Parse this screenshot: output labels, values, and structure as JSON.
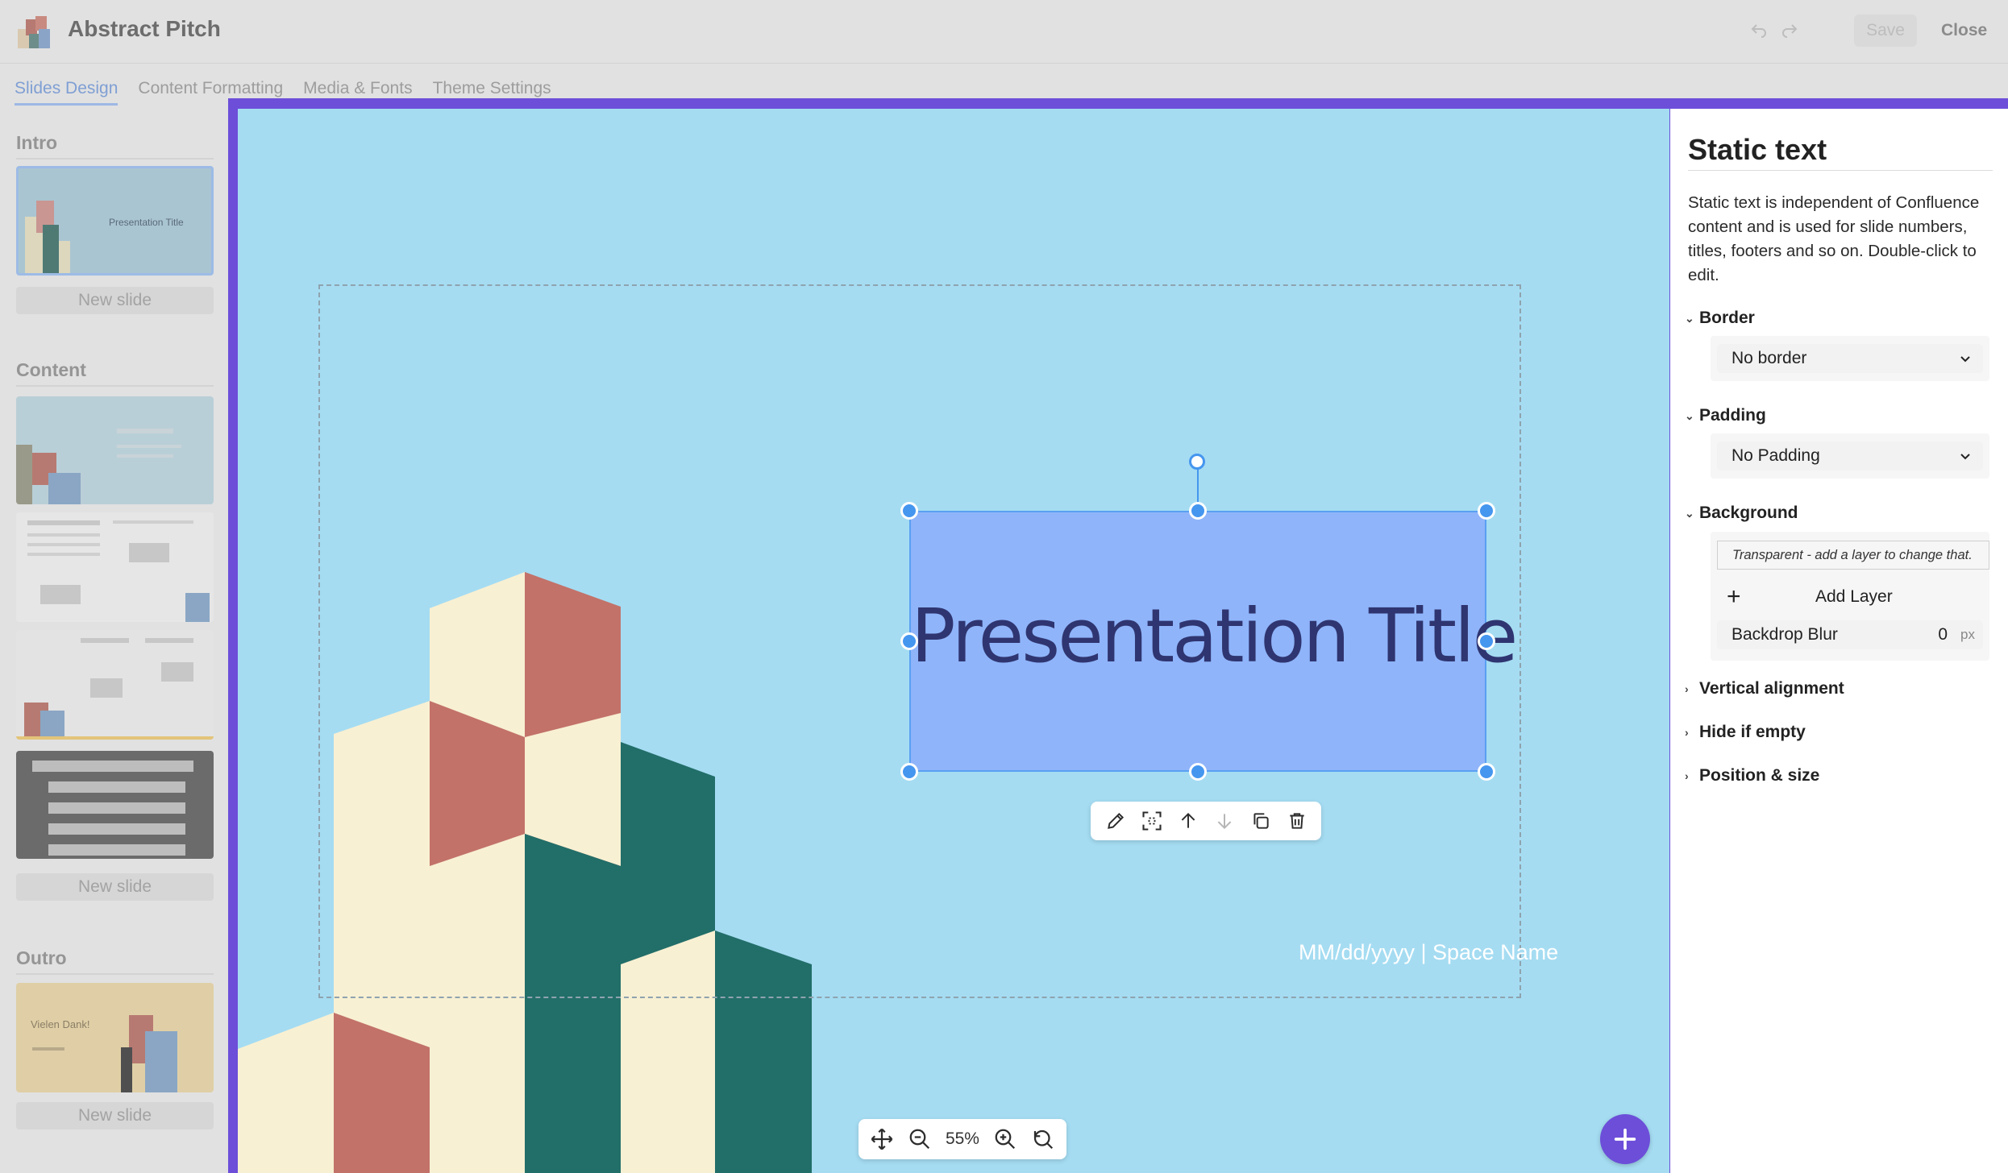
{
  "app": {
    "title": "Abstract Pitch",
    "save_label": "Save",
    "close_label": "Close"
  },
  "tabs": [
    {
      "label": "Slides Design",
      "active": true
    },
    {
      "label": "Content Formatting",
      "active": false
    },
    {
      "label": "Media & Fonts",
      "active": false
    },
    {
      "label": "Theme Settings",
      "active": false
    }
  ],
  "sidebar": {
    "intro": {
      "title": "Intro",
      "thumb_text": "Presentation Title",
      "new_slide": "New slide"
    },
    "content": {
      "title": "Content",
      "new_slide": "New slide"
    },
    "outro": {
      "title": "Outro",
      "thumb_text": "Vielen Dank!",
      "new_slide": "New slide"
    }
  },
  "slide": {
    "title": "Presentation Title",
    "footer": "MM/dd/yyyy | Space Name"
  },
  "zoom": {
    "value": "55%"
  },
  "panel": {
    "title": "Static text",
    "description": "Static text is independent of Confluence content and is used for slide numbers, titles, footers and so on. Double-click to edit.",
    "border": {
      "label": "Border",
      "value": "No border"
    },
    "padding": {
      "label": "Padding",
      "value": "No Padding"
    },
    "background": {
      "label": "Background",
      "note": "Transparent - add a layer to change that.",
      "add_layer": "Add Layer",
      "blur_label": "Backdrop Blur",
      "blur_value": "0",
      "blur_unit": "px"
    },
    "vertical_alignment": "Vertical alignment",
    "hide_if_empty": "Hide if empty",
    "position_size": "Position & size"
  },
  "colors": {
    "accent": "#6c4ed9",
    "canvas": "#a5dcf2",
    "selection": "#4596ef",
    "title_box": "#8fb4fa",
    "title_text": "#2f3570",
    "cream": "#f8f0d3",
    "terracotta": "#c27269",
    "teal": "#226e69"
  },
  "icons": {
    "toolbar": [
      "pencil-icon",
      "crop-icon",
      "arrow-up-icon",
      "arrow-down-icon",
      "duplicate-icon",
      "trash-icon"
    ],
    "zoom": [
      "move-icon",
      "zoom-out-icon",
      "zoom-in-icon",
      "reset-zoom-icon"
    ]
  }
}
